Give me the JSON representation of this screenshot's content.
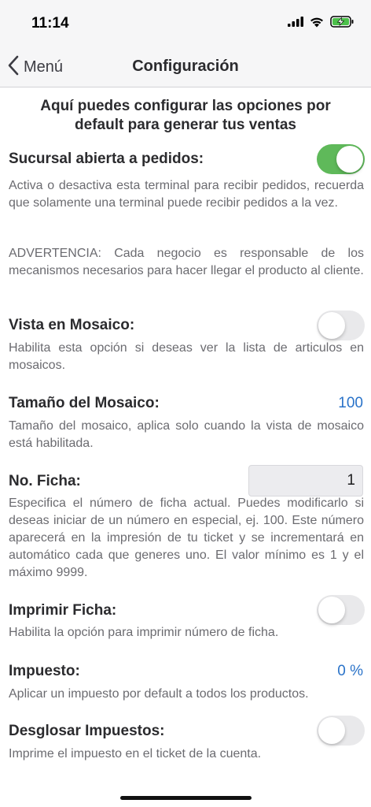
{
  "status_bar": {
    "time": "11:14"
  },
  "nav": {
    "back_label": "Menú",
    "title": "Configuración"
  },
  "intro": "Aquí puedes configurar las opciones por default para generar tus ventas",
  "settings": {
    "sucursal": {
      "title": "Sucursal abierta a pedidos:",
      "enabled": true,
      "description": "Activa o desactiva esta terminal para recibir pedidos, recuerda que solamente una terminal puede recibir pedidos a la vez.",
      "warning": "ADVERTENCIA: Cada negocio es responsable de los mecanismos necesarios para hacer llegar el producto al cliente."
    },
    "mosaico": {
      "title": "Vista en Mosaico:",
      "enabled": false,
      "description": "Habilita esta opción si deseas ver la lista de articulos en mosaicos."
    },
    "tamano": {
      "title": "Tamaño del Mosaico:",
      "value": "100",
      "description": "Tamaño del mosaico, aplica solo cuando la vista de mosaico está habilitada."
    },
    "ficha": {
      "title": "No. Ficha:",
      "value": "1",
      "description": "Especifica el número de ficha actual. Puedes modificarlo si deseas iniciar de un número en especial, ej. 100. Este número aparecerá en la impresión de tu ticket y se incrementará en automático cada que generes uno. El valor mínimo es 1 y el máximo 9999."
    },
    "imprimir_ficha": {
      "title": "Imprimir Ficha:",
      "enabled": false,
      "description": "Habilita la opción para imprimir número de ficha."
    },
    "impuesto": {
      "title": "Impuesto:",
      "value": "0 %",
      "description": "Aplicar un impuesto por default a todos los productos."
    },
    "desglosar": {
      "title": "Desglosar Impuestos:",
      "enabled": false,
      "description": "Imprime el impuesto en el ticket de la cuenta."
    }
  },
  "colors": {
    "accent": "#2a73c9",
    "toggle_on": "#5fb95a",
    "toggle_off": "#e9e9eb"
  }
}
